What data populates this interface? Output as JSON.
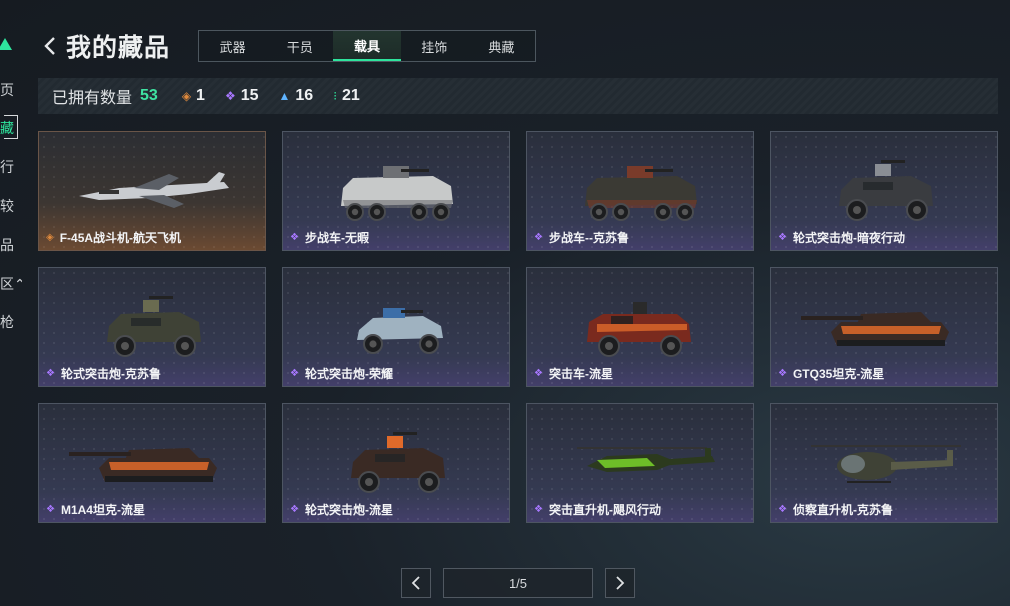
{
  "nav": {
    "items": [
      {
        "label": "页",
        "active": false
      },
      {
        "label": "藏",
        "active": true
      },
      {
        "label": "行",
        "active": false
      },
      {
        "label": "较",
        "active": false
      },
      {
        "label": "品",
        "active": false
      },
      {
        "label": "区⌃",
        "active": false
      },
      {
        "label": "枪",
        "active": false
      }
    ]
  },
  "header": {
    "title": "我的藏品"
  },
  "tabs": [
    {
      "label": "武器",
      "active": false
    },
    {
      "label": "干员",
      "active": false
    },
    {
      "label": "载具",
      "active": true
    },
    {
      "label": "挂饰",
      "active": false
    },
    {
      "label": "典藏",
      "active": false
    }
  ],
  "stats": {
    "owned_label": "已拥有数量",
    "owned_total": "53",
    "rarities": [
      {
        "icon": "gold-rarity-icon",
        "glyph": "◈",
        "color": "#e08a3c",
        "count": "1"
      },
      {
        "icon": "purple-rarity-icon",
        "glyph": "❖",
        "color": "#a878ff",
        "count": "15"
      },
      {
        "icon": "blue-rarity-icon",
        "glyph": "▲",
        "color": "#5fb4ff",
        "count": "16"
      },
      {
        "icon": "green-rarity-icon",
        "glyph": "⁝",
        "color": "#2ee59d",
        "count": "21"
      }
    ]
  },
  "items": [
    {
      "name": "F-45A战斗机-航天飞机",
      "rarity": "gold",
      "kind": "jet",
      "body": "#c9ccd0",
      "accent": "#5b5f66"
    },
    {
      "name": "步战车-无暇",
      "rarity": "purple",
      "kind": "apc",
      "body": "#c7c9c9",
      "accent": "#6e7074"
    },
    {
      "name": "步战车--克苏鲁",
      "rarity": "purple",
      "kind": "apc",
      "body": "#3b3a34",
      "accent": "#7a3b2a"
    },
    {
      "name": "轮式突击炮-暗夜行动",
      "rarity": "purple",
      "kind": "armored-car",
      "body": "#3a3c40",
      "accent": "#8a8e94"
    },
    {
      "name": "轮式突击炮-克苏鲁",
      "rarity": "purple",
      "kind": "armored-car",
      "body": "#3f4236",
      "accent": "#6a6b50"
    },
    {
      "name": "轮式突击炮-荣耀",
      "rarity": "purple",
      "kind": "buggy",
      "body": "#9fb2c0",
      "accent": "#3c6ea8"
    },
    {
      "name": "突击车-流星",
      "rarity": "purple",
      "kind": "truck",
      "body": "#7a2a1e",
      "accent": "#e06a2a"
    },
    {
      "name": "GTQ35坦克-流星",
      "rarity": "purple",
      "kind": "tank",
      "body": "#3a2a24",
      "accent": "#e06a2a"
    },
    {
      "name": "M1A4坦克-流星",
      "rarity": "purple",
      "kind": "tank",
      "body": "#3a2a24",
      "accent": "#e06a2a"
    },
    {
      "name": "轮式突击炮-流星",
      "rarity": "purple",
      "kind": "armored-car",
      "body": "#3a2a24",
      "accent": "#e06a2a"
    },
    {
      "name": "突击直升机-飓风行动",
      "rarity": "purple",
      "kind": "attack-heli",
      "body": "#2c3a1e",
      "accent": "#7fe02a"
    },
    {
      "name": "侦察直升机-克苏鲁",
      "rarity": "purple",
      "kind": "scout-heli",
      "body": "#3f4236",
      "accent": "#5a5c48"
    }
  ],
  "pagination": {
    "indicator": "1/5"
  }
}
